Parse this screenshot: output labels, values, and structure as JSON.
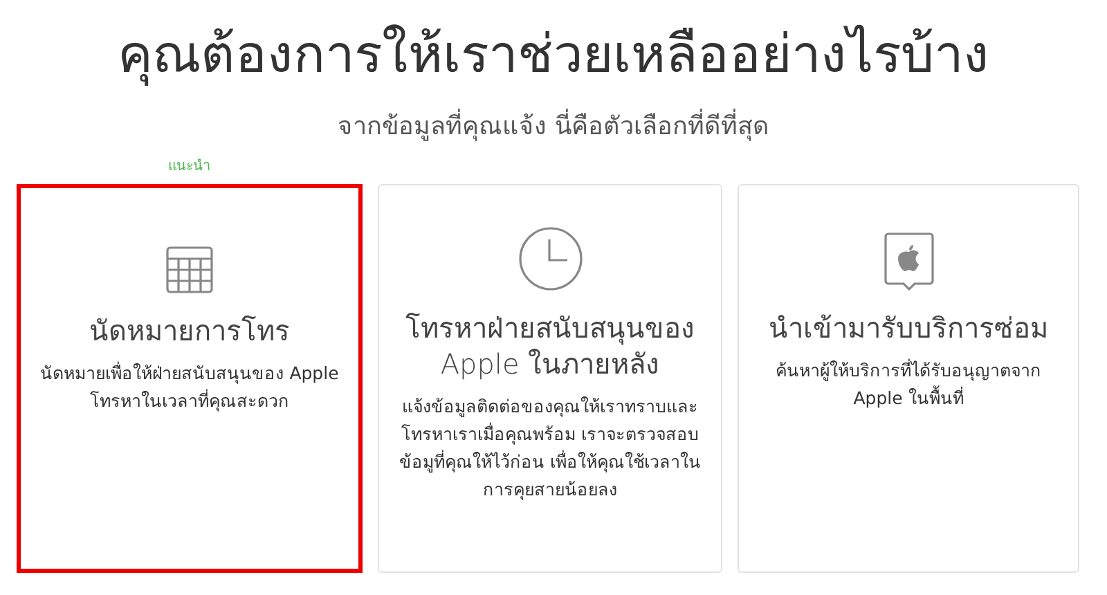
{
  "heading": "คุณต้องการให้เราช่วยเหลืออย่างไรบ้าง",
  "subheading": "จากข้อมูลที่คุณแจ้ง นี่คือตัวเลือกที่ดีที่สุด",
  "recommended_label": "แนะนำ",
  "options": [
    {
      "kind": "calendar",
      "title": "นัดหมายการโทร",
      "description": "นัดหมายเพื่อให้ฝ่ายสนับสนุนของ Apple โทรหาในเวลาที่คุณสะดวก",
      "selected": true
    },
    {
      "kind": "clock",
      "title": "โทรหาฝ่ายสนับสนุนของ Apple ในภายหลัง",
      "description": "แจ้งข้อมูลติดต่อของคุณให้เราทราบและ โทรหาเราเมื่อคุณพร้อม เราจะตรวจสอบข้อมูที่คุณให้ไว้ก่อน เพื่อให้คุณใช้เวลาในการคุยสายน้อยลง",
      "selected": false
    },
    {
      "kind": "repair",
      "title": "นำเข้ามารับบริการซ่อม",
      "description": "ค้นหาผู้ให้บริการที่ได้รับอนุญาตจาก Apple ในพื้นที่",
      "selected": false
    }
  ]
}
